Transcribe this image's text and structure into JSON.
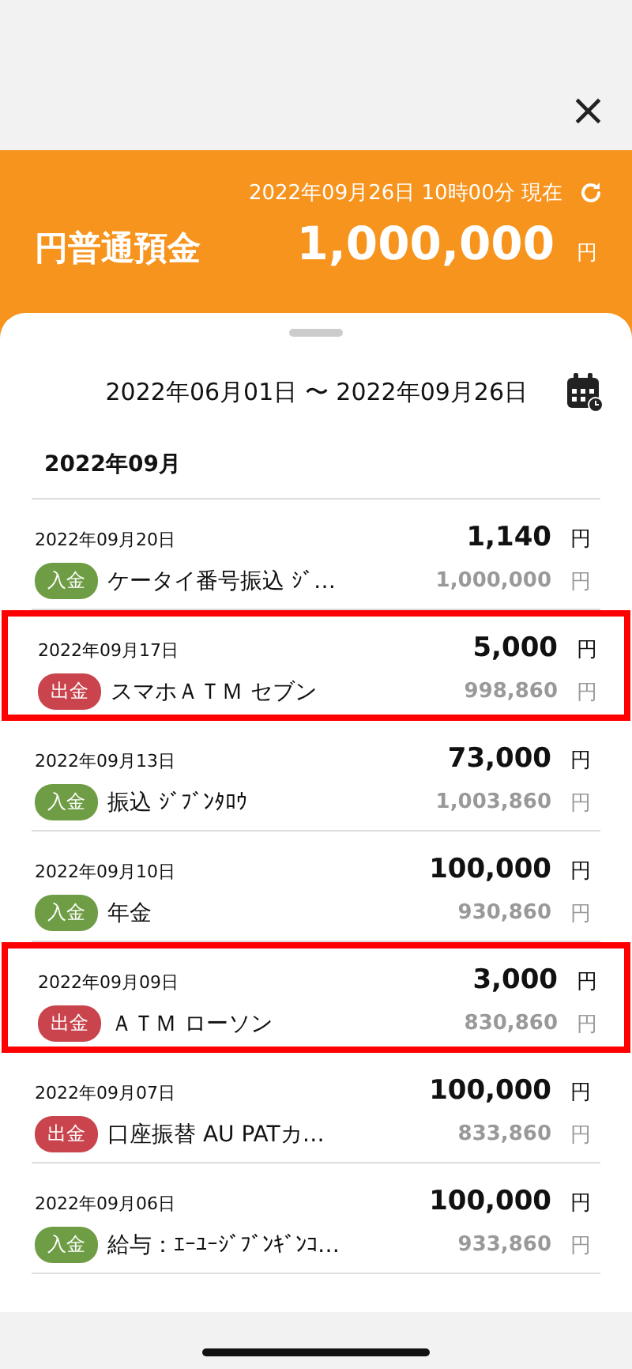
{
  "close_button": "×",
  "balance": {
    "as_of": "2022年09月26日 10時00分 現在",
    "account": "円普通預金",
    "amount": "1,000,000",
    "unit": "円"
  },
  "period": "2022年06月01日 〜 2022年09月26日",
  "month": "2022年09月",
  "transactions": [
    {
      "date": "2022年09月20日",
      "kind": "deposit",
      "badge": "入金",
      "description": "ケータイ番号振込 ｼﾞ…",
      "amount": "1,140",
      "amount_unit": "円",
      "balance": "1,000,000",
      "balance_unit": "円",
      "highlighted": false
    },
    {
      "date": "2022年09月17日",
      "kind": "withdrawal",
      "badge": "出金",
      "description": "スマホＡＴＭ セブン",
      "amount": "5,000",
      "amount_unit": "円",
      "balance": "998,860",
      "balance_unit": "円",
      "highlighted": true
    },
    {
      "date": "2022年09月13日",
      "kind": "deposit",
      "badge": "入金",
      "description": "振込 ｼﾞﾌﾞﾝﾀﾛｳ",
      "amount": "73,000",
      "amount_unit": "円",
      "balance": "1,003,860",
      "balance_unit": "円",
      "highlighted": false
    },
    {
      "date": "2022年09月10日",
      "kind": "deposit",
      "badge": "入金",
      "description": "年金",
      "amount": "100,000",
      "amount_unit": "円",
      "balance": "930,860",
      "balance_unit": "円",
      "highlighted": false
    },
    {
      "date": "2022年09月09日",
      "kind": "withdrawal",
      "badge": "出金",
      "description": "ＡＴＭ ローソン",
      "amount": "3,000",
      "amount_unit": "円",
      "balance": "830,860",
      "balance_unit": "円",
      "highlighted": true
    },
    {
      "date": "2022年09月07日",
      "kind": "withdrawal",
      "badge": "出金",
      "description": "口座振替 AU PATカ…",
      "amount": "100,000",
      "amount_unit": "円",
      "balance": "833,860",
      "balance_unit": "円",
      "highlighted": false
    },
    {
      "date": "2022年09月06日",
      "kind": "deposit",
      "badge": "入金",
      "description": "給与：ｴｰﾕｰｼﾞﾌﾞﾝｷﾞﾝｺ…",
      "amount": "100,000",
      "amount_unit": "円",
      "balance": "933,860",
      "balance_unit": "円",
      "highlighted": false
    }
  ]
}
